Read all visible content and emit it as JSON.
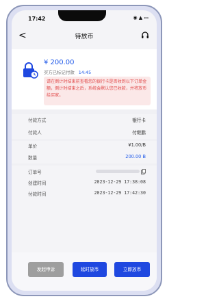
{
  "status": {
    "time": "17:42",
    "icons": "◉ ▲ ▭"
  },
  "header": {
    "title": "待放币",
    "back": "<"
  },
  "order": {
    "amount": "¥ 200.00",
    "buyer_paid": "买方已标记付款",
    "countdown": "14:45",
    "notice": "请在倒计时结束前查看您的银行卡是否收到以下订单金额，倒计时结束之后，系统会默认您已收款，并将放币给买家。"
  },
  "details": {
    "payment_method_label": "付款方式",
    "payment_method": "银行卡",
    "payer_label": "付款人",
    "payer": "付继鹏",
    "unit_price_label": "单价",
    "unit_price": "¥1.00/B",
    "quantity_label": "数量",
    "quantity": "200.00 B",
    "order_no_label": "订单号",
    "created_label": "创建时间",
    "created": "2023-12-29 17:38:08",
    "paid_label": "付款时间",
    "paid": "2023-12-29 17:42:30"
  },
  "actions": {
    "appeal": "发起申诉",
    "delay": "延时放币",
    "release": "立即放币"
  },
  "colors": {
    "accent": "#1f48e0",
    "alert_text": "#e14b4b",
    "alert_bg": "#fbe8e8"
  }
}
